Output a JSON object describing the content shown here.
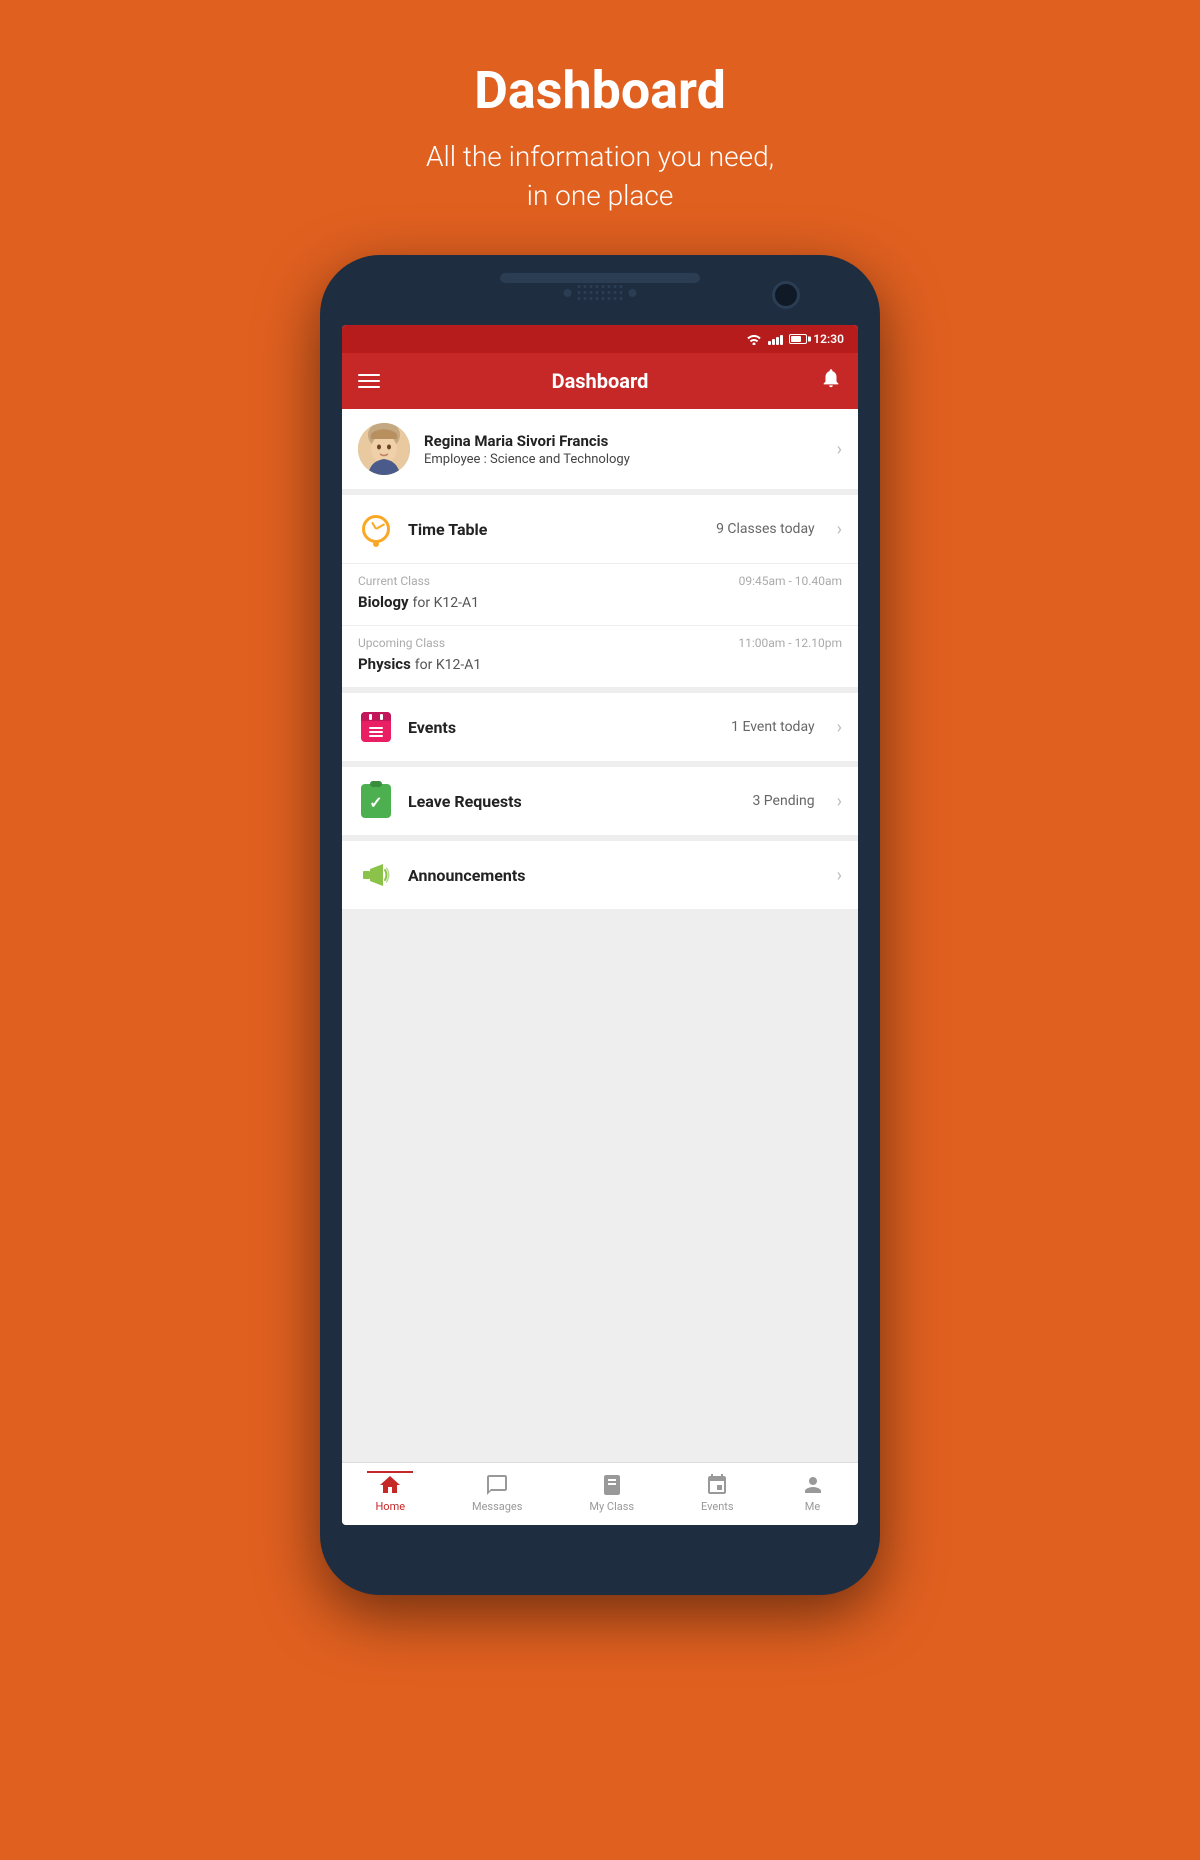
{
  "page": {
    "bg_color": "#E06020",
    "header": {
      "title": "Dashboard",
      "subtitle_line1": "All the information you need,",
      "subtitle_line2": "in one place"
    }
  },
  "status_bar": {
    "time": "12:30"
  },
  "app_bar": {
    "title": "Dashboard",
    "menu_icon": "≡",
    "bell_icon": "🔔"
  },
  "profile": {
    "name": "Regina Maria Sivori Francis",
    "role_label": "Employee : ",
    "role_value": "Science and Technology"
  },
  "timetable": {
    "title": "Time Table",
    "count": "9 Classes today",
    "current_class": {
      "label": "Current Class",
      "time": "09:45am - 10.40am",
      "subject": "Biology",
      "group": "for K12-A1"
    },
    "upcoming_class": {
      "label": "Upcoming Class",
      "time": "11:00am - 12.10pm",
      "subject": "Physics",
      "group": "for K12-A1"
    }
  },
  "events": {
    "title": "Events",
    "count": "1 Event today"
  },
  "leave_requests": {
    "title": "Leave Requests",
    "count": "3 Pending"
  },
  "announcements": {
    "title": "Announcements"
  },
  "bottom_nav": {
    "items": [
      {
        "id": "home",
        "label": "Home",
        "active": true
      },
      {
        "id": "messages",
        "label": "Messages",
        "active": false
      },
      {
        "id": "myclass",
        "label": "My Class",
        "active": false
      },
      {
        "id": "events",
        "label": "Events",
        "active": false
      },
      {
        "id": "me",
        "label": "Me",
        "active": false
      }
    ]
  }
}
